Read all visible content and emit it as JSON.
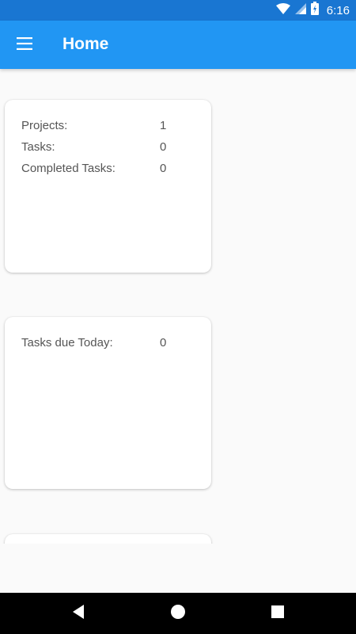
{
  "status_bar": {
    "time": "6:16",
    "icons": [
      "wifi-icon",
      "cell-signal-icon",
      "battery-icon"
    ]
  },
  "app_bar": {
    "title": "Home",
    "menu_icon": "hamburger-menu-icon",
    "color": "#2196f3"
  },
  "cards": [
    {
      "rows": [
        {
          "label": "Projects:",
          "value": "1"
        },
        {
          "label": "Tasks:",
          "value": "0"
        },
        {
          "label": "Completed Tasks:",
          "value": "0"
        }
      ]
    },
    {
      "rows": [
        {
          "label": "Tasks due Today:",
          "value": "0"
        }
      ]
    }
  ],
  "nav_bar": {
    "buttons": [
      "back-icon",
      "home-icon",
      "recents-icon"
    ]
  }
}
